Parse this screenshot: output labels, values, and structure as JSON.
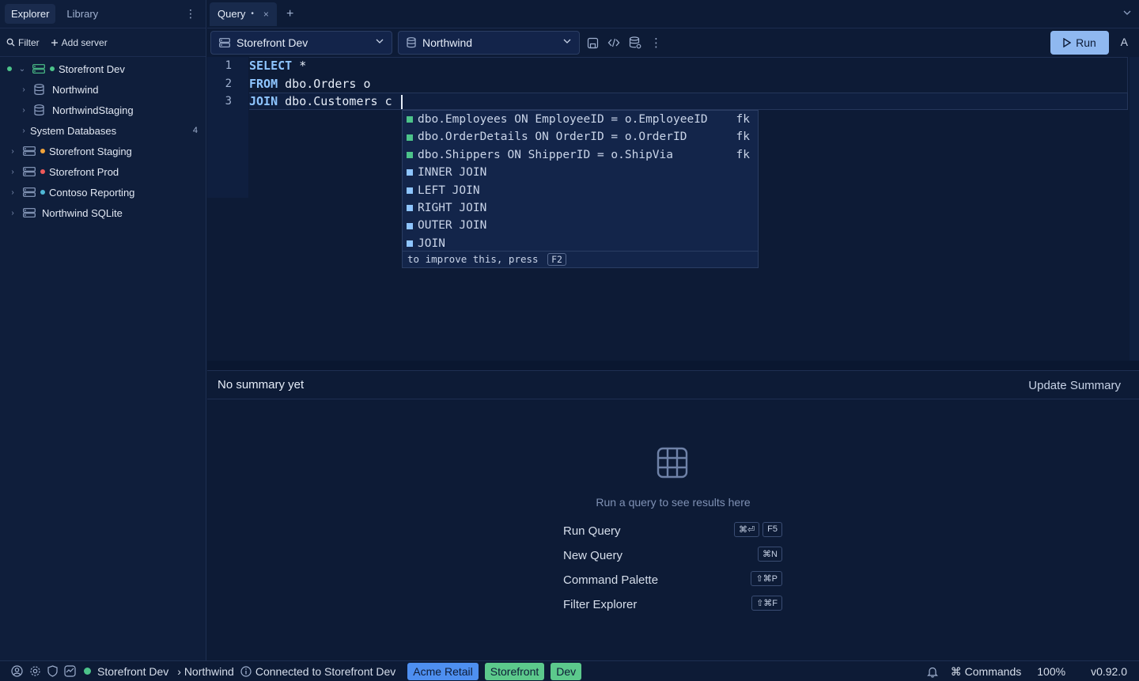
{
  "sidebar": {
    "tabs": [
      "Explorer",
      "Library"
    ],
    "actions": {
      "filter": "Filter",
      "add_server": "Add server"
    },
    "tree": [
      {
        "label": "Storefront Dev",
        "level": 0,
        "expanded": true,
        "dot": "#4cc38a",
        "type": "server",
        "active": true
      },
      {
        "label": "Northwind",
        "level": 1,
        "type": "database"
      },
      {
        "label": "NorthwindStaging",
        "level": 1,
        "type": "database"
      },
      {
        "label": "System Databases",
        "level": 1,
        "type": "folder",
        "count": "4"
      },
      {
        "label": "Storefront Staging",
        "level": 0,
        "dot": "#f2a33a",
        "type": "server"
      },
      {
        "label": "Storefront Prod",
        "level": 0,
        "dot": "#ef5a5a",
        "type": "server"
      },
      {
        "label": "Contoso Reporting",
        "level": 0,
        "dot": "#4fb8d6",
        "type": "server"
      },
      {
        "label": "Northwind SQLite",
        "level": 0,
        "type": "server"
      }
    ]
  },
  "tabs": {
    "active_label": "Query",
    "dirty_marker": "•",
    "close_glyph": "×",
    "add_glyph": "+"
  },
  "toolbar": {
    "server_select": "Storefront Dev",
    "database_select": "Northwind",
    "run_label": "Run",
    "extra_label": "A"
  },
  "editor": {
    "line_numbers": [
      "1",
      "2",
      "3"
    ],
    "lines": [
      {
        "kw": "SELECT",
        "rest": " *"
      },
      {
        "kw": "FROM",
        "rest": " dbo.Orders o"
      },
      {
        "kw": "JOIN",
        "rest": " dbo.Customers c "
      }
    ]
  },
  "autocomplete": {
    "items": [
      {
        "text": "dbo.Employees ON EmployeeID = o.EmployeeID",
        "kind": "fk",
        "color": "#4cc38a"
      },
      {
        "text": "dbo.OrderDetails ON OrderID = o.OrderID",
        "kind": "fk",
        "color": "#4cc38a"
      },
      {
        "text": "dbo.Shippers ON ShipperID = o.ShipVia",
        "kind": "fk",
        "color": "#4cc38a"
      },
      {
        "text": "INNER JOIN",
        "kind": "",
        "color": "#8ec5ff"
      },
      {
        "text": "LEFT JOIN",
        "kind": "",
        "color": "#8ec5ff"
      },
      {
        "text": "RIGHT JOIN",
        "kind": "",
        "color": "#8ec5ff"
      },
      {
        "text": "OUTER JOIN",
        "kind": "",
        "color": "#8ec5ff"
      },
      {
        "text": "JOIN",
        "kind": "",
        "color": "#8ec5ff"
      }
    ],
    "footer_text": "to improve this, press",
    "footer_key": "F2"
  },
  "summary": {
    "text": "No summary yet",
    "update_label": "Update Summary"
  },
  "results": {
    "hint": "Run a query to see results here",
    "shortcuts": [
      {
        "label": "Run Query",
        "keys": [
          "⌘⏎",
          "F5"
        ]
      },
      {
        "label": "New Query",
        "keys": [
          "⌘N"
        ]
      },
      {
        "label": "Command Palette",
        "keys": [
          "⇧⌘P"
        ]
      },
      {
        "label": "Filter Explorer",
        "keys": [
          "⇧⌘F"
        ]
      }
    ]
  },
  "statusbar": {
    "server": "Storefront Dev",
    "database": "› Northwind",
    "connection": "Connected to Storefront Dev",
    "chips": [
      {
        "label": "Acme Retail",
        "color": "#4e8ff0"
      },
      {
        "label": "Storefront",
        "color": "#5cc98c"
      },
      {
        "label": "Dev",
        "color": "#5cc98c"
      }
    ],
    "commands": "Commands",
    "zoom": "100%",
    "version": "v0.92.0"
  },
  "colors": {
    "accent": "#8fb8f0",
    "online": "#4cc38a"
  }
}
